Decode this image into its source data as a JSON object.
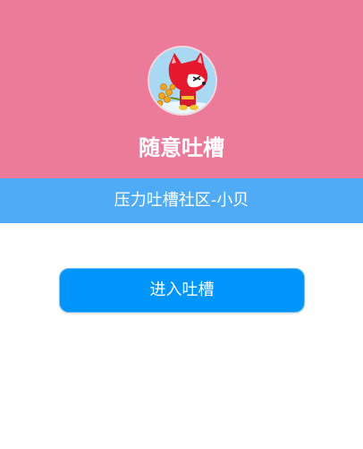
{
  "header": {
    "avatar_icon": "cartoon-fox-avatar-icon",
    "title": "随意吐槽",
    "background_color": "#ec7b99"
  },
  "subheader": {
    "text": "压力吐槽社区-小贝",
    "background_color": "#4fabf6"
  },
  "actions": {
    "enter_label": "进入吐槽",
    "button_color": "#0095fb"
  }
}
